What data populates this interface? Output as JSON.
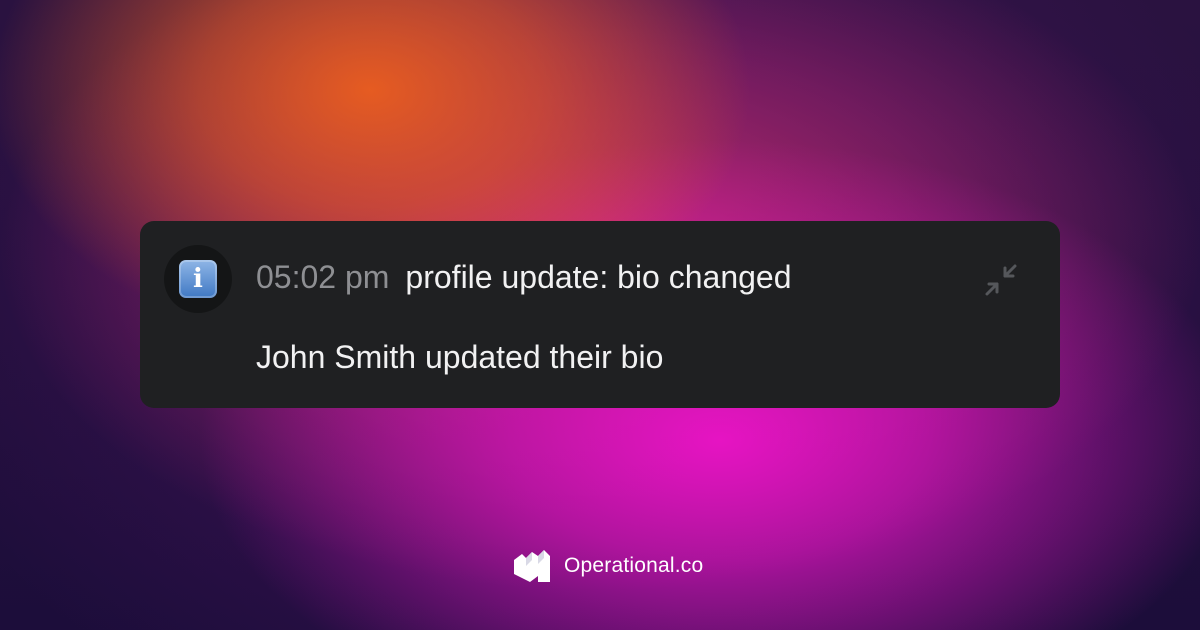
{
  "notification": {
    "icon": "information-emoji",
    "timestamp": "05:02 pm",
    "title": "profile update: bio changed",
    "message": "John Smith updated their bio",
    "collapse_icon": "collapse-arrows-icon"
  },
  "footer": {
    "brand": "Operational.co",
    "logo_icon": "operational-logo"
  },
  "colors": {
    "card_background": "#1f2022",
    "timestamp": "#8e8f93",
    "text": "#f1f1f2",
    "accent_orange": "#ec5f1e",
    "accent_magenta": "#ec14c8"
  }
}
